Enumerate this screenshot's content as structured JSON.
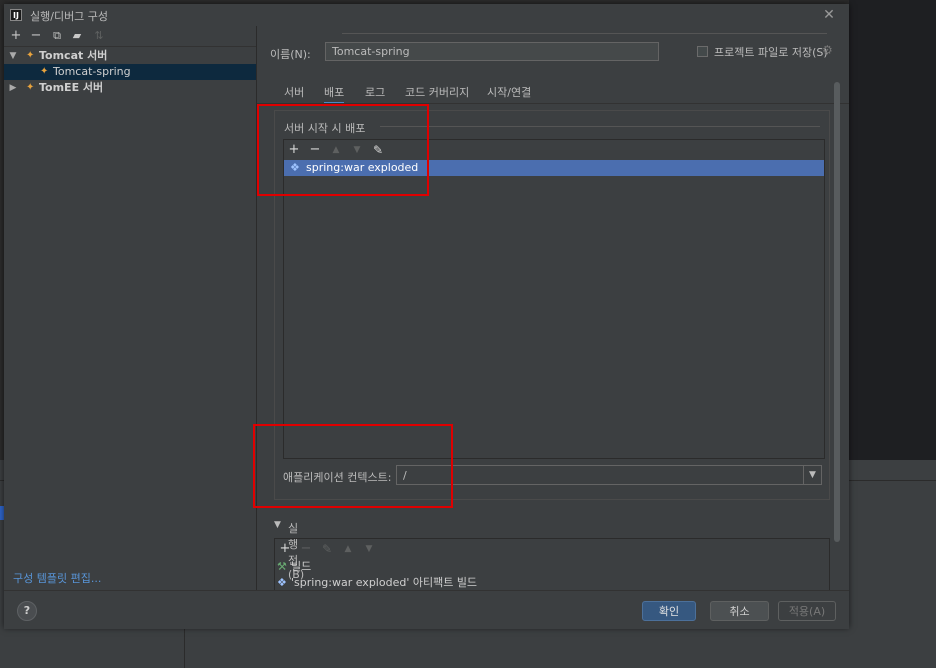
{
  "window": {
    "title": "실행/디버그 구성",
    "app_icon": "IJ",
    "close_icon": "close-icon"
  },
  "left": {
    "toolbar_icons": [
      "plus-icon",
      "minus-icon",
      "copy-icon",
      "folder-icon",
      "sort-icon"
    ],
    "tree": [
      {
        "label": "Tomcat 서버",
        "expanded": true,
        "level": 0
      },
      {
        "label": "Tomcat-spring",
        "level": 1,
        "selected": true
      },
      {
        "label": "TomEE 서버",
        "expanded": false,
        "level": 0
      }
    ],
    "templates_link": "구성 템플릿 편집..."
  },
  "form": {
    "name_label": "이름(N):",
    "name_value": "Tomcat-spring",
    "store_label": "프로젝트 파일로 저장(S)",
    "store_checked": false
  },
  "tabs": [
    {
      "label": "서버",
      "active": false
    },
    {
      "label": "배포",
      "active": true
    },
    {
      "label": "로그",
      "active": false
    },
    {
      "label": "코드 커버리지",
      "active": false
    },
    {
      "label": "시작/연결",
      "active": false
    }
  ],
  "deploy": {
    "section_title": "서버 시작 시 배포",
    "toolbar": [
      "plus-icon",
      "minus-icon",
      "move-up-icon",
      "move-down-icon",
      "edit-icon"
    ],
    "items": [
      {
        "label": "spring:war exploded",
        "selected": true
      }
    ],
    "context_label": "애플리케이션 컨텍스트:",
    "context_value": "/"
  },
  "before_launch": {
    "label": "실행 전(B)",
    "items": [
      {
        "icon": "hammer-icon",
        "label": "빌드"
      },
      {
        "icon": "artifact-icon",
        "label": "'spring:war exploded' 아티팩트 빌드"
      }
    ]
  },
  "buttons": {
    "ok": "확인",
    "cancel": "취소",
    "apply": "적용(A)",
    "help": "?"
  },
  "colors": {
    "accent": "#4b6eaf",
    "annotation": "#e00000",
    "link": "#5895d8"
  }
}
